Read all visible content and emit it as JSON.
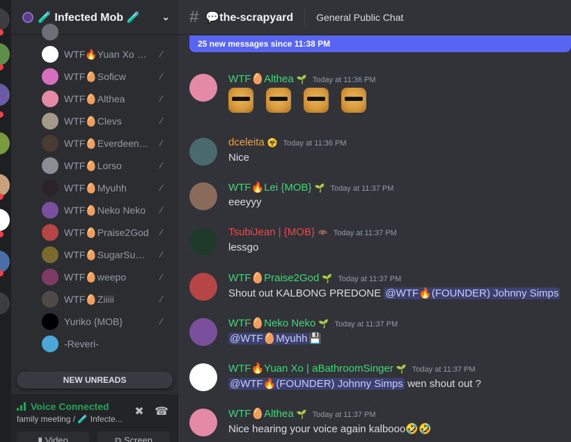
{
  "server": {
    "name": "🧪 Infected Mob 🧪"
  },
  "members": [
    {
      "name": "",
      "color": "#6c6f77"
    },
    {
      "name": "WTF🔥Yuan Xo | a...",
      "color": "#ffffff"
    },
    {
      "name": "WTF🥚Soficw",
      "color": "#d86ec0"
    },
    {
      "name": "WTF🥚Althea",
      "color": "#e58aa6"
    },
    {
      "name": "WTF🥚Clevs",
      "color": "#a39a8c"
    },
    {
      "name": "WTF🥚Everdeen Xo",
      "color": "#4a3b33"
    },
    {
      "name": "WTF🥚Lorso",
      "color": "#8a8d93"
    },
    {
      "name": "WTF🥚Myuhh",
      "color": "#2c2228"
    },
    {
      "name": "WTF🥚Neko Neko",
      "color": "#7a4f9e"
    },
    {
      "name": "WTF🥚Praise2God",
      "color": "#b84545"
    },
    {
      "name": "WTF🥚SugarSugar",
      "color": "#7a6a2e"
    },
    {
      "name": "WTF🥚weepo",
      "color": "#803a66"
    },
    {
      "name": "WTF🥚Ziiiii",
      "color": "#4f4a46"
    },
    {
      "name": "Yuriko {MOB}",
      "color": "#000000"
    },
    {
      "name": "-Reveri-",
      "color": "#4aa7d8"
    }
  ],
  "new_unreads": "NEW UNREADS",
  "voice": {
    "status": "Voice Connected",
    "channel": "family meeting / 🧪 Infecte...",
    "video_label": "Video",
    "screen_label": "Screen"
  },
  "channel": {
    "name": "💬​the-scrapyard",
    "topic": "General Public Chat",
    "new_messages_banner": "25 new messages since 11:38 PM"
  },
  "messages": [
    {
      "author": "WTF🥚Althea",
      "badge": "🌱",
      "time": "Today at 11:36 PM",
      "text": "",
      "author_class": "g",
      "avatar_color": "#e58aa6",
      "emojis": 4
    },
    {
      "author": "dceleita",
      "badge": "☣️",
      "time": "Today at 11:36 PM",
      "text": "Nice",
      "author_class": "o",
      "avatar_color": "#4a6a6e"
    },
    {
      "author": "WTF🔥Lei {MOB}",
      "badge": "🌱",
      "time": "Today at 11:37 PM",
      "text": "eeeyyy",
      "author_class": "g",
      "avatar_color": "#8a6a58"
    },
    {
      "author": "TsubiJean | {MOB}",
      "badge": "🦇",
      "time": "Today at 11:37 PM",
      "text": "lessgo",
      "author_class": "r",
      "avatar_color": "#1f3a2a"
    },
    {
      "author": "WTF🥚Praise2God",
      "badge": "🌱",
      "time": "Today at 11:37 PM",
      "text": "Shout out KALBONG PREDONE ",
      "mention": "@WTF🔥(FOUNDER) Johnny Simps",
      "author_class": "g",
      "avatar_color": "#b84545"
    },
    {
      "author": "WTF🥚Neko Neko",
      "badge": "🌱",
      "time": "Today at 11:37 PM",
      "text": "",
      "mention": "@WTF🥚Myuhh",
      "after": "💾",
      "author_class": "g",
      "avatar_color": "#7a4f9e"
    },
    {
      "author": "WTF🔥Yuan Xo | aBathroomSinger",
      "badge": "🌱",
      "time": "Today at 11:37 PM",
      "text": "",
      "mention": "@WTF🔥(FOUNDER) Johnny Simps",
      "after": " wen shout out ?",
      "author_class": "g",
      "avatar_color": "#ffffff"
    },
    {
      "author": "WTF🥚Althea",
      "badge": "🌱",
      "time": "Today at 11:37 PM",
      "text": "Nice hearing your voice again kalbooo🤣🤣",
      "author_class": "g",
      "avatar_color": "#e58aa6"
    }
  ],
  "colors": {
    "sidebar_bg": "#2b2d31",
    "chat_bg": "#313338",
    "accent": "#5865f2",
    "voice_green": "#23a559"
  }
}
